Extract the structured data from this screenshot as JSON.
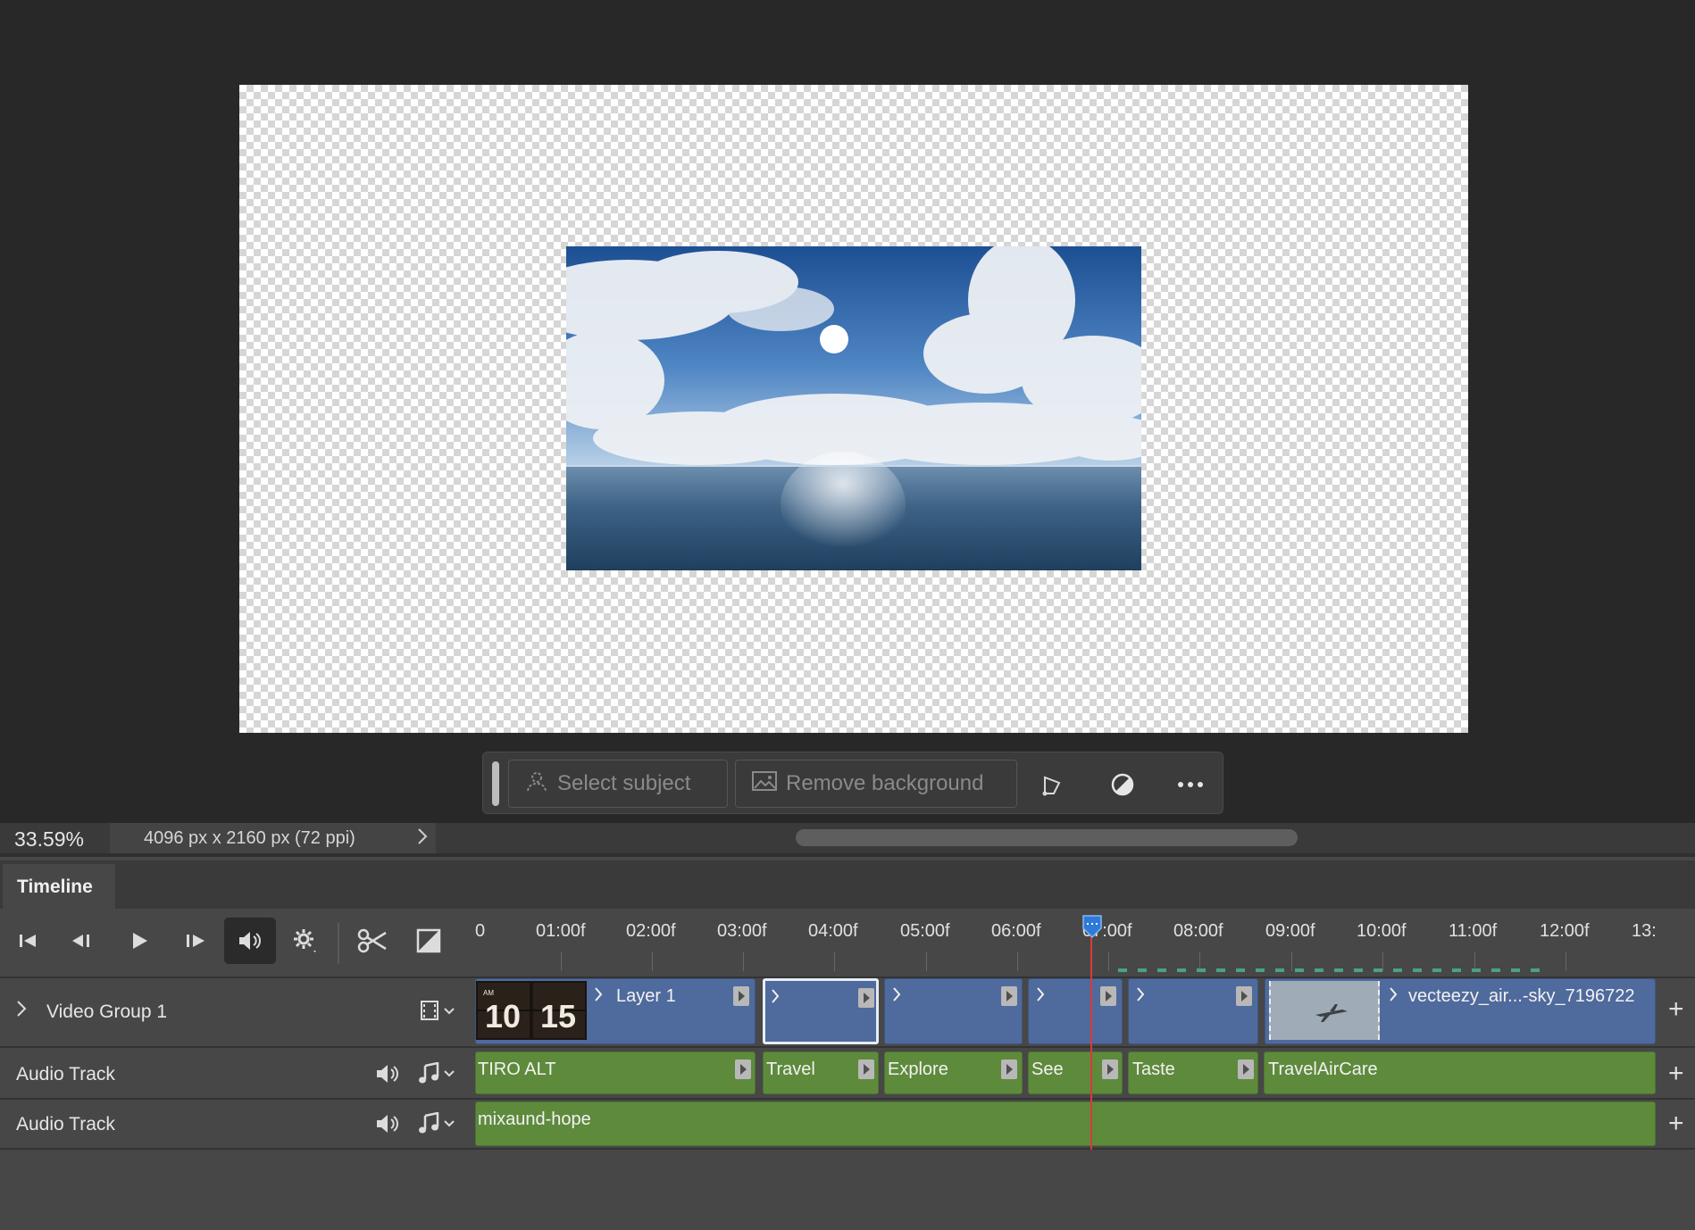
{
  "taskbar": {
    "select_subject": "Select subject",
    "remove_background": "Remove background"
  },
  "status": {
    "zoom": "33.59%",
    "doc_size": "4096 px x 2160 px (72 ppi)"
  },
  "timeline": {
    "tab_label": "Timeline",
    "ruler_labels": [
      "0",
      "01:00f",
      "02:00f",
      "03:00f",
      "04:00f",
      "05:00f",
      "06:00f",
      "07:00f",
      "08:00f",
      "09:00f",
      "10:00f",
      "11:00f",
      "12:00f",
      "13:"
    ],
    "tracks": {
      "video_group": {
        "name": "Video Group 1",
        "clips": [
          "Layer 1",
          "",
          "",
          "",
          "",
          "vecteezy_air...-sky_7196722"
        ]
      },
      "audio1": {
        "name": "Audio Track",
        "clips": [
          "TIRO ALT",
          "Travel",
          "Explore",
          "See",
          "Taste",
          "TravelAirCare"
        ]
      },
      "audio2": {
        "name": "Audio Track",
        "clips": [
          "mixaund-hope"
        ]
      }
    }
  },
  "colors": {
    "video_clip": "#4f6a9c",
    "audio_clip": "#5e8a3c",
    "playhead": "#d83a3a"
  }
}
